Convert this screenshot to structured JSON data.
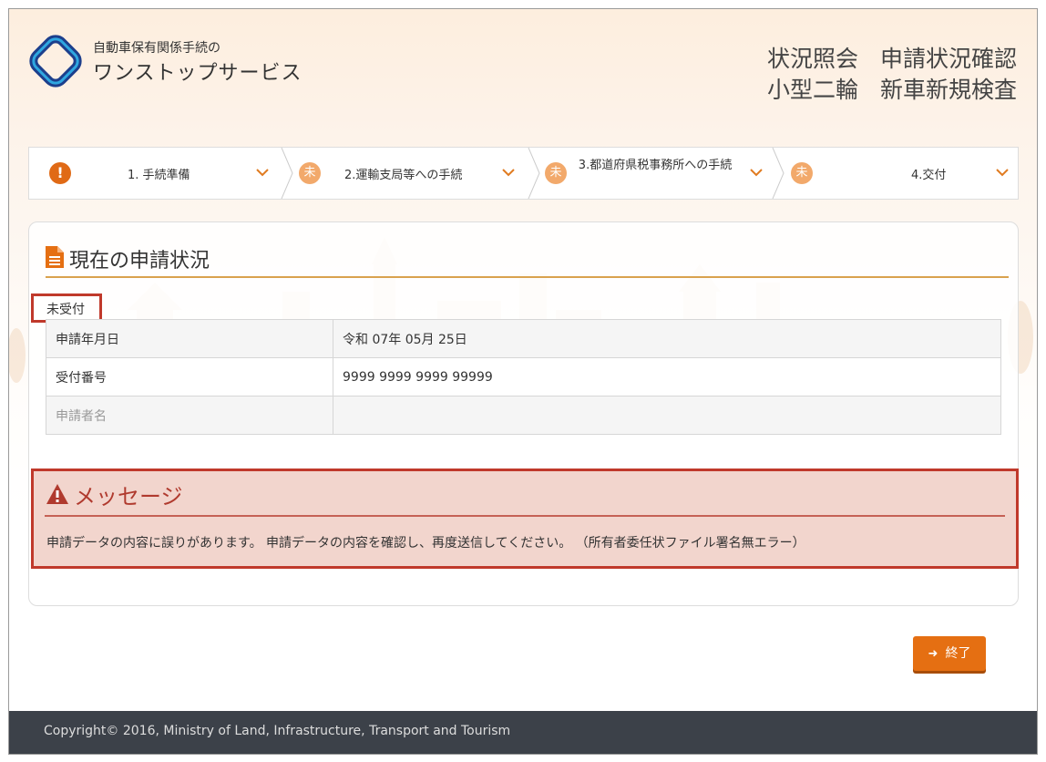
{
  "header": {
    "brand_sub": "自動車保有関係手続の",
    "brand_main": "ワンストップサービス",
    "title_line1_a": "状況照会",
    "title_line1_b": "申請状況確認",
    "title_line2_a": "小型二輪",
    "title_line2_b": "新車新規検査"
  },
  "steps": [
    {
      "badge": "!",
      "label": "1. 手続準備",
      "state": "warning"
    },
    {
      "badge": "未",
      "label": "2.運輸支局等への手続",
      "state": "pending"
    },
    {
      "badge": "未",
      "label": "3.都道府県税事務所への手続",
      "state": "pending"
    },
    {
      "badge": "未",
      "label": "4.交付",
      "state": "pending"
    }
  ],
  "status_section": {
    "title": "現在の申請状況",
    "status": "未受付",
    "rows": [
      {
        "label": "申請年月日",
        "value": "令和 07年 05月 25日"
      },
      {
        "label": "受付番号",
        "value": "9999 9999 9999 99999"
      },
      {
        "label": "申請者名",
        "value": ""
      }
    ]
  },
  "message": {
    "title": "メッセージ",
    "text": "申請データの内容に誤りがあります。 申請データの内容を確認し、再度送信してください。 （所有者委任状ファイル署名無エラー）"
  },
  "buttons": {
    "end": "終了"
  },
  "footer": {
    "copyright": "Copyright© 2016, Ministry of Land, Infrastructure, Transport and Tourism"
  },
  "colors": {
    "accent": "#e56f12",
    "error_border": "#c0392b",
    "error_bg": "#f2d5cd",
    "footer_bg": "#3c4149"
  }
}
